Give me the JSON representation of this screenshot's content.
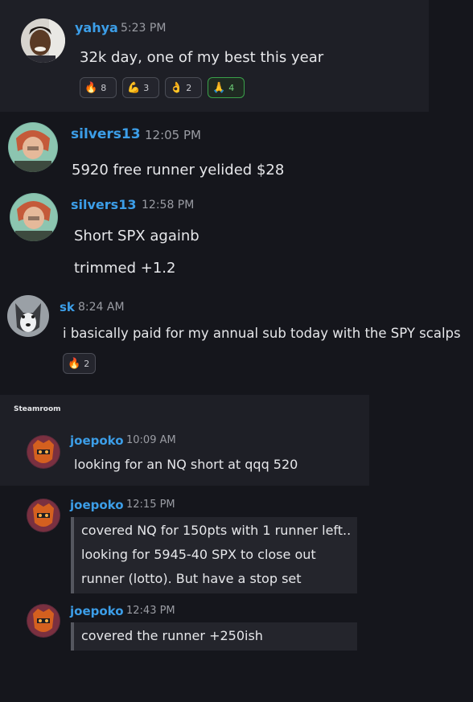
{
  "colors": {
    "background": "#15161c",
    "panel": "#1e1f26",
    "steamroom_panel": "#1e1f26",
    "username": "#3c9ee8",
    "reaction_active": "#3aa14a"
  },
  "messages": [
    {
      "author": "yahya",
      "time": "5:23 PM",
      "text": "32k day, one of my best this year",
      "reactions": [
        {
          "icon": "fire-emoji",
          "glyph": "🔥",
          "count": "8"
        },
        {
          "icon": "flexed-biceps-emoji",
          "glyph": "💪",
          "count": "3"
        },
        {
          "icon": "ok-hand-emoji",
          "glyph": "👌",
          "count": "2"
        },
        {
          "icon": "folded-hands-emoji",
          "glyph": "🙏",
          "count": "4"
        }
      ]
    },
    {
      "author": "silvers13",
      "time": "12:05 PM",
      "text": "5920 free runner yelided $28"
    },
    {
      "author": "silvers13",
      "time": "12:58 PM",
      "lines": [
        "Short SPX againb",
        "trimmed +1.2"
      ]
    },
    {
      "author": "sk",
      "time": "8:24 AM",
      "text": "i basically paid for my annual sub today with the SPY scalps",
      "reactions": [
        {
          "icon": "fire-emoji",
          "glyph": "🔥",
          "count": "2"
        }
      ]
    }
  ],
  "steamroom": {
    "channel_label": "Steamroom",
    "posts": [
      {
        "author": "joepoko",
        "time": "10:09 AM",
        "text": "looking for an NQ short at qqq 520"
      },
      {
        "author": "joepoko",
        "time": "12:15 PM",
        "quote_lines": [
          "covered NQ for 150pts with 1 runner left..",
          "looking for 5945-40 SPX to close out",
          "runner (lotto). But have a stop set"
        ]
      },
      {
        "author": "joepoko",
        "time": "12:43 PM",
        "quote_lines": [
          "covered the runner +250ish"
        ]
      }
    ]
  }
}
